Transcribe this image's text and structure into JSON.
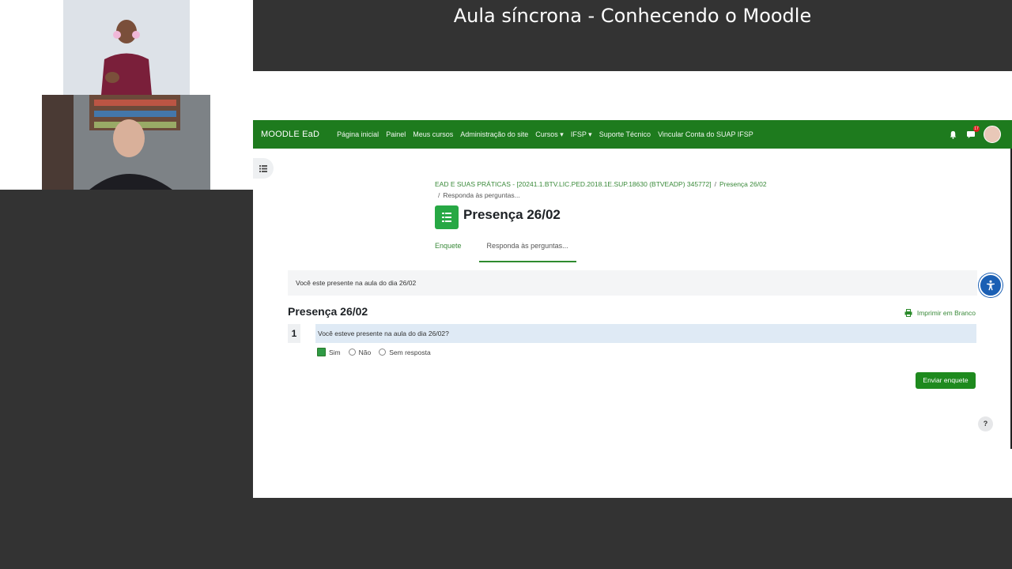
{
  "stream": {
    "title": "Aula síncrona - Conhecendo o Moodle"
  },
  "navbar": {
    "brand": "MOODLE EaD",
    "menu": [
      "Página inicial",
      "Painel",
      "Meus cursos",
      "Administração do site",
      "Cursos ▾",
      "IFSP ▾",
      "Suporte Técnico",
      "Vincular Conta do SUAP IFSP"
    ],
    "notification_badge": "17"
  },
  "breadcrumb": {
    "course": "EAD E SUAS PRÁTICAS - [20241.1.BTV.LIC.PED.2018.1E.SUP.18630 (BTVEADP) 345772]",
    "activity": "Presença 26/02",
    "current": "Responda às perguntas..."
  },
  "page": {
    "title": "Presença 26/02"
  },
  "tabs": [
    "Enquete",
    "Responda às perguntas..."
  ],
  "intro": "Você este presente na aula do dia 26/02",
  "survey": {
    "title": "Presença 26/02",
    "print_link": "Imprimir em Branco",
    "question_number": "1",
    "question_text": "Você esteve presente na aula do dia 26/02?",
    "options": [
      "Sim",
      "Não",
      "Sem resposta"
    ],
    "selected": "Sim",
    "submit_label": "Enviar enquete"
  },
  "help": "?"
}
